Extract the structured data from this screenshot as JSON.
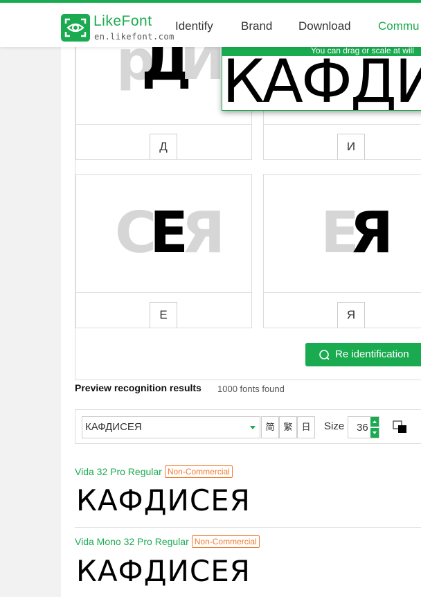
{
  "header": {
    "logo_title_a": "Like",
    "logo_title_b": "Font",
    "logo_sub": "en.likefont.com",
    "nav": [
      "Identify",
      "Brand",
      "Download",
      "Commu"
    ]
  },
  "overlay": {
    "hint": "You can drag or scale at will",
    "text": "КАФДИСЕЯ"
  },
  "cells": [
    {
      "label": "Д",
      "ghost_left": "р",
      "main": "Д",
      "ghost_right": "И"
    },
    {
      "label": "И",
      "ghost_left": "",
      "main": "",
      "ghost_right": ""
    },
    {
      "label": "Е",
      "ghost_left": "С",
      "main": "Е",
      "ghost_right": "Я"
    },
    {
      "label": "Я",
      "ghost_left": "Е",
      "main": "Я",
      "ghost_right": ""
    }
  ],
  "reid_button": "Re identification",
  "results": {
    "title": "Preview recognition results",
    "count": "1000 fonts found"
  },
  "toolbar": {
    "sample_text": "КАФДИСЕЯ",
    "btn_simplified": "简",
    "btn_traditional": "繁",
    "btn_japanese": "日",
    "size_label": "Size",
    "size_value": "36"
  },
  "fonts": [
    {
      "name": "Vida 32 Pro Regular",
      "license": "Non-Commercial",
      "sample": "КАФДИСЕЯ"
    },
    {
      "name": "Vida Mono 32 Pro Regular",
      "license": "Non-Commercial",
      "sample": "КАФДИСЕЯ"
    }
  ],
  "colors": {
    "accent": "#1aab50",
    "badge": "#f07a2f"
  }
}
